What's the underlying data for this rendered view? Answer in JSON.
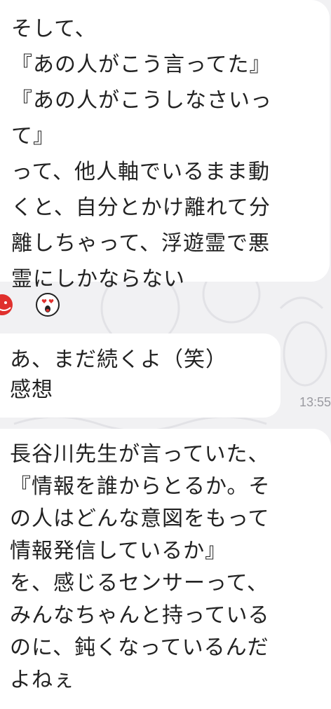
{
  "messages": [
    {
      "lines": [
        "そして、",
        "『あの人がこう言ってた』",
        "『あの人がこうしなさいっ",
        "て』",
        "って、他人軸でいるまま動",
        "くと、自分とかけ離れて分",
        "離しちゃって、浮遊霊で悪",
        "霊にしかならない"
      ]
    },
    {
      "lines": [
        "あ、まだ続くよ（笑）",
        "感想"
      ],
      "time": "13:55"
    },
    {
      "lines": [
        "長谷川先生が言っていた、",
        "『情報を誰からとるか。そ",
        "の人はどんな意図をもって",
        "情報発信しているか』",
        "を、感じるセンサーって、",
        "みんなちゃんと持っている",
        "のに、鈍くなっているんだ",
        "よねぇ"
      ]
    }
  ],
  "reactions": [
    {
      "icon": "smile-emoji-icon",
      "color": "#e0302d"
    },
    {
      "icon": "heart-eyes-emoji-icon",
      "color": "#e0302d"
    }
  ]
}
